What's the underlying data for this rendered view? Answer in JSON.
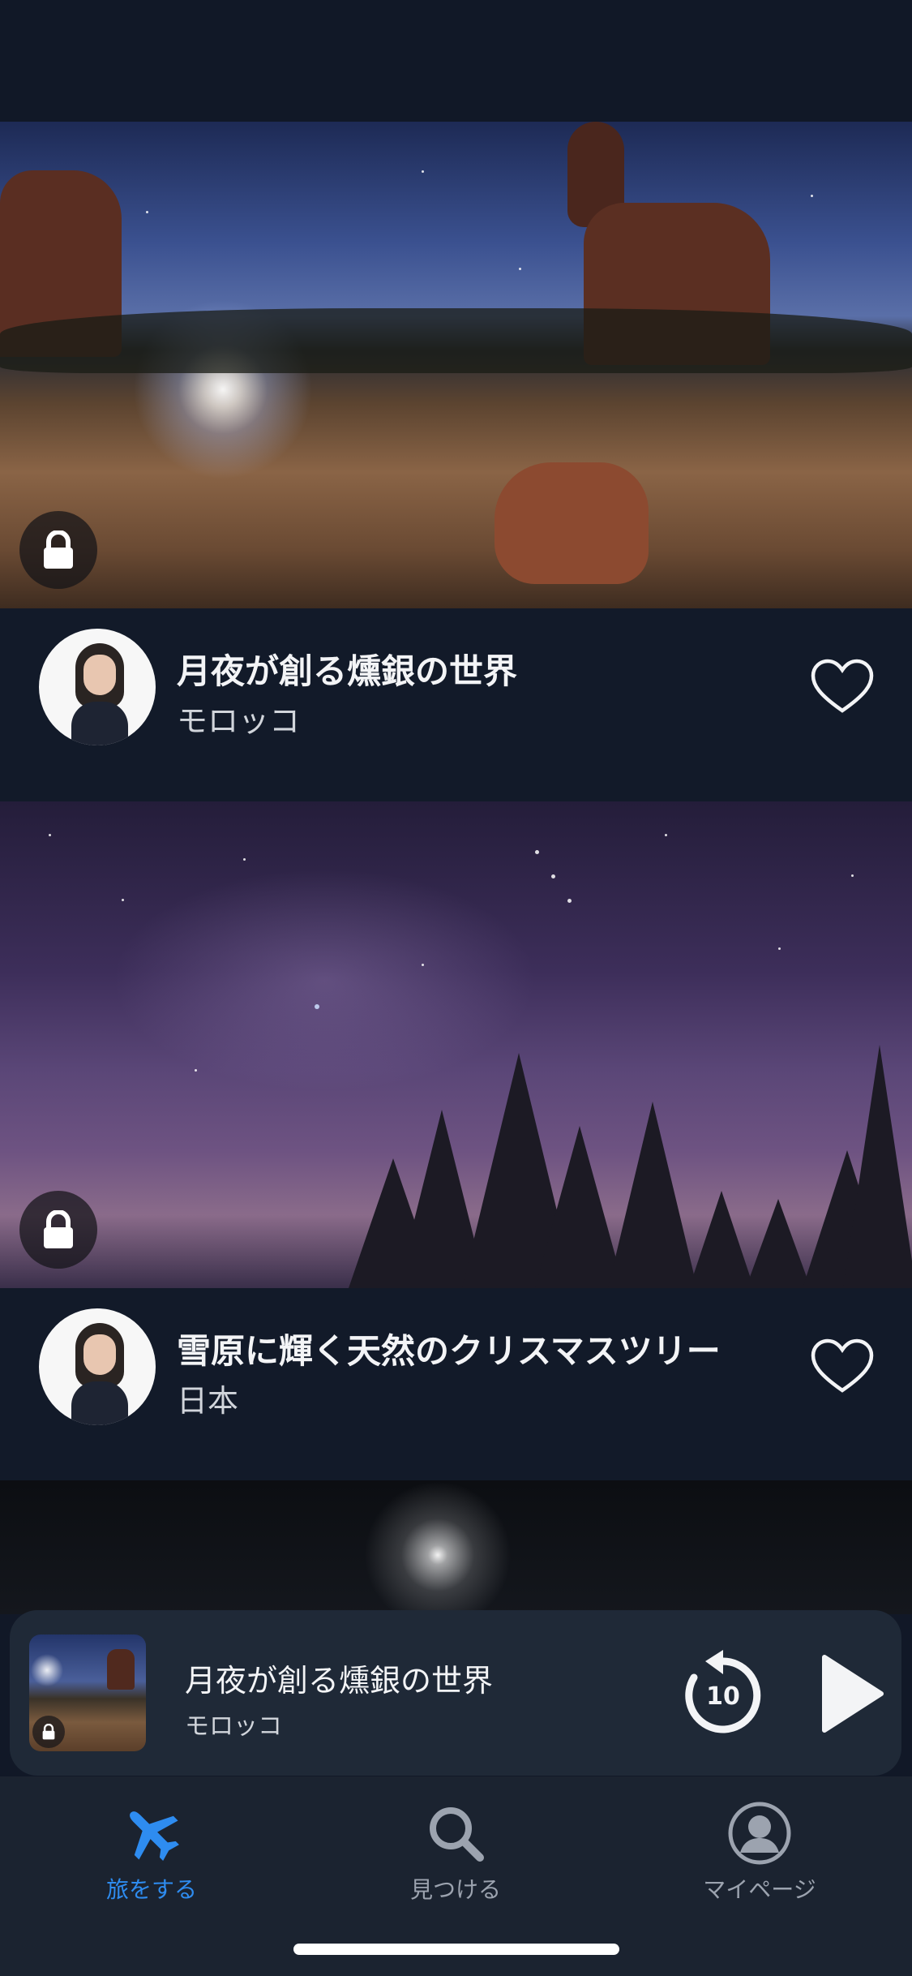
{
  "cards": [
    {
      "title": "月夜が創る燻銀の世界",
      "subtitle": "モロッコ",
      "locked": true,
      "favorited": false
    },
    {
      "title": "雪原に輝く天然のクリスマスツリー",
      "subtitle": "日本",
      "locked": true,
      "favorited": false
    }
  ],
  "mini_player": {
    "title": "月夜が創る燻銀の世界",
    "subtitle": "モロッコ",
    "replay_seconds": "10",
    "state": "paused"
  },
  "tab_bar": {
    "tabs": [
      {
        "label": "旅をする",
        "icon": "airplane-icon",
        "active": true
      },
      {
        "label": "見つける",
        "icon": "search-icon",
        "active": false
      },
      {
        "label": "マイページ",
        "icon": "profile-icon",
        "active": false
      }
    ]
  },
  "colors": {
    "background": "#111827",
    "card_info_bg": "#121a29",
    "player_bg": "#1f2937",
    "accent_active": "#2e8cf0",
    "inactive_tab": "#9ca3af"
  }
}
